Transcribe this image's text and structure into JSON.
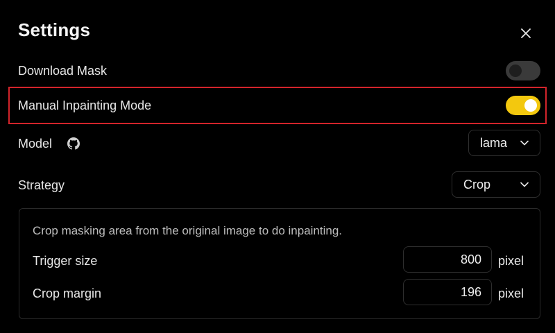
{
  "dialog": {
    "title": "Settings",
    "close_icon": "close-icon"
  },
  "settings": {
    "download_mask": {
      "label": "Download Mask",
      "enabled": false
    },
    "manual_inpainting": {
      "label": "Manual Inpainting Mode",
      "enabled": true
    },
    "model": {
      "label": "Model",
      "icon": "github-icon",
      "value": "lama"
    },
    "strategy": {
      "label": "Strategy",
      "value": "Crop"
    }
  },
  "strategy_details": {
    "description": "Crop masking area from the original image to do inpainting.",
    "trigger_size": {
      "label": "Trigger size",
      "value": "800",
      "unit": "pixel"
    },
    "crop_margin": {
      "label": "Crop margin",
      "value": "196",
      "unit": "pixel"
    }
  },
  "colors": {
    "background": "#000000",
    "toggle_on": "#f3c80e",
    "toggle_off": "#3a3a3a",
    "highlight": "#d3242b"
  }
}
